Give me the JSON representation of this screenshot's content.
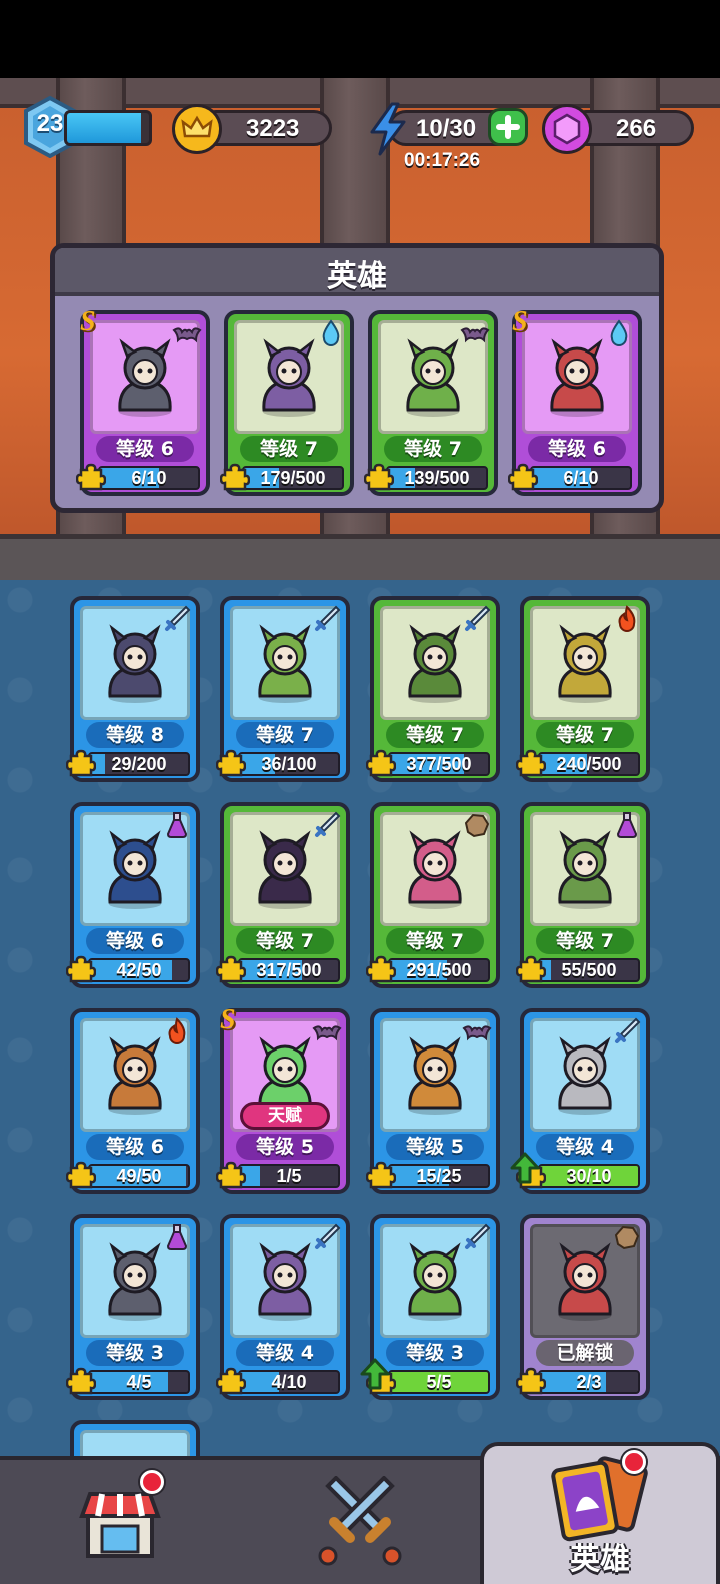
{
  "hud": {
    "player_level": "23",
    "xp_fill": 0.9,
    "coins": "3223",
    "energy": "10/30",
    "energy_timer": "00:17:26",
    "gems": "266"
  },
  "team": {
    "title": "英雄",
    "cards": [
      {
        "level": "等级 6",
        "progress": "6/10",
        "fill": 0.6,
        "rarity": "purple",
        "s_rank": "S",
        "type_icon": "bat-icon"
      },
      {
        "level": "等级 7",
        "progress": "179/500",
        "fill": 0.36,
        "rarity": "green",
        "s_rank": "",
        "type_icon": "water-drop-icon"
      },
      {
        "level": "等级 7",
        "progress": "139/500",
        "fill": 0.28,
        "rarity": "green",
        "s_rank": "",
        "type_icon": "bat-icon"
      },
      {
        "level": "等级 6",
        "progress": "6/10",
        "fill": 0.6,
        "rarity": "purple",
        "s_rank": "S",
        "type_icon": "water-drop-icon"
      }
    ]
  },
  "heroes": [
    {
      "level": "等级 8",
      "progress": "29/200",
      "fill": 0.15,
      "rarity": "blue",
      "type_icon": "sword-icon"
    },
    {
      "level": "等级 7",
      "progress": "36/100",
      "fill": 0.36,
      "rarity": "blue",
      "type_icon": "sword-icon"
    },
    {
      "level": "等级 7",
      "progress": "377/500",
      "fill": 0.75,
      "rarity": "green",
      "type_icon": "sword-icon"
    },
    {
      "level": "等级 7",
      "progress": "240/500",
      "fill": 0.48,
      "rarity": "green",
      "type_icon": "fire-icon"
    },
    {
      "level": "等级 6",
      "progress": "42/50",
      "fill": 0.84,
      "rarity": "blue",
      "type_icon": "potion-icon"
    },
    {
      "level": "等级 7",
      "progress": "317/500",
      "fill": 0.63,
      "rarity": "green",
      "type_icon": "sword-icon"
    },
    {
      "level": "等级 7",
      "progress": "291/500",
      "fill": 0.58,
      "rarity": "green",
      "type_icon": "rock-icon"
    },
    {
      "level": "等级 7",
      "progress": "55/500",
      "fill": 0.11,
      "rarity": "green",
      "type_icon": "potion-icon"
    },
    {
      "level": "等级 6",
      "progress": "49/50",
      "fill": 0.98,
      "rarity": "blue",
      "type_icon": "fire-icon"
    },
    {
      "level": "等级 5",
      "progress": "1/5",
      "fill": 0.2,
      "rarity": "purple",
      "type_icon": "bat-icon",
      "s_rank": "S",
      "talent": "天赋"
    },
    {
      "level": "等级 5",
      "progress": "15/25",
      "fill": 0.6,
      "rarity": "blue",
      "type_icon": "bat-icon"
    },
    {
      "level": "等级 4",
      "progress": "30/10",
      "fill": 1.0,
      "rarity": "blue",
      "type_icon": "sword-icon",
      "upgrade": true
    },
    {
      "level": "等级 3",
      "progress": "4/5",
      "fill": 0.8,
      "rarity": "blue",
      "type_icon": "potion-icon"
    },
    {
      "level": "等级 4",
      "progress": "4/10",
      "fill": 0.4,
      "rarity": "blue",
      "type_icon": "sword-icon"
    },
    {
      "level": "等级 3",
      "progress": "5/5",
      "fill": 1.0,
      "rarity": "blue",
      "type_icon": "sword-icon",
      "upgrade": true
    },
    {
      "level": "已解锁",
      "progress": "2/3",
      "fill": 0.67,
      "rarity": "gray",
      "type_icon": "rock-icon"
    }
  ],
  "nav": {
    "shop_icon": "shop-icon",
    "battle_icon": "crossed-swords-icon",
    "heroes_label": "英雄"
  },
  "colors": {
    "blue_card": "#2c95e6",
    "green_card": "#55b839",
    "purple_card": "#b04ed8",
    "progress_blue": "#3aa6e8",
    "progress_green": "#6fd43a"
  }
}
